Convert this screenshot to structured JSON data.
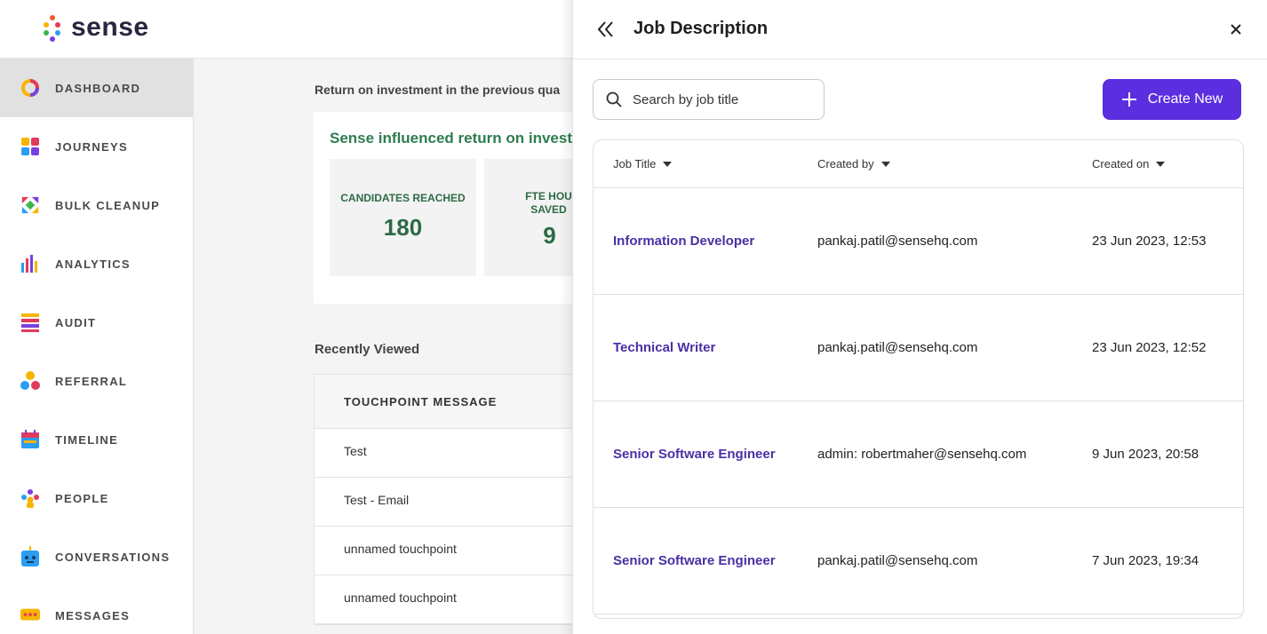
{
  "app": {
    "logo_text": "sense"
  },
  "sidebar": {
    "items": [
      {
        "label": "DASHBOARD",
        "icon": "dashboard-ring-icon",
        "active": true
      },
      {
        "label": "JOURNEYS",
        "icon": "journeys-grid-icon"
      },
      {
        "label": "BULK CLEANUP",
        "icon": "bulk-cleanup-arrows-icon"
      },
      {
        "label": "ANALYTICS",
        "icon": "analytics-bars-icon"
      },
      {
        "label": "AUDIT",
        "icon": "audit-list-icon"
      },
      {
        "label": "REFERRAL",
        "icon": "referral-nodes-icon"
      },
      {
        "label": "TIMELINE",
        "icon": "timeline-calendar-icon"
      },
      {
        "label": "PEOPLE",
        "icon": "people-group-icon"
      },
      {
        "label": "CONVERSATIONS",
        "icon": "conversations-robot-icon"
      },
      {
        "label": "MESSAGES",
        "icon": "messages-bubble-icon"
      }
    ]
  },
  "main": {
    "roi_title": "Return on investment in the previous qua",
    "roi_card_title": "Sense influenced return on investr",
    "stats": [
      {
        "label": "CANDIDATES REACHED",
        "value": "180"
      },
      {
        "label": "FTE HOU SAVED",
        "value": "9"
      }
    ],
    "recent_title": "Recently Viewed",
    "recent_header": "TOUCHPOINT MESSAGE",
    "recent_rows": [
      "Test",
      "Test - Email",
      "unnamed touchpoint",
      "unnamed touchpoint"
    ]
  },
  "drawer": {
    "title": "Job Description",
    "search_placeholder": "Search by job title",
    "create_label": "Create New",
    "columns": [
      "Job Title",
      "Created by",
      "Created on"
    ],
    "rows": [
      {
        "title": "Information Developer",
        "created_by": "pankaj.patil@sensehq.com",
        "created_on": "23 Jun 2023, 12:53"
      },
      {
        "title": "Technical Writer",
        "created_by": "pankaj.patil@sensehq.com",
        "created_on": "23 Jun 2023, 12:52"
      },
      {
        "title": "Senior Software Engineer",
        "created_by": "admin: robertmaher@sensehq.com",
        "created_on": "9 Jun 2023, 20:58"
      },
      {
        "title": "Senior Software Engineer",
        "created_by": "pankaj.patil@sensehq.com",
        "created_on": "7 Jun 2023, 19:34"
      }
    ]
  },
  "colors": {
    "accent": "#5b2ee0",
    "link": "#4a2fa3",
    "stat_green": "#2d6a45"
  }
}
